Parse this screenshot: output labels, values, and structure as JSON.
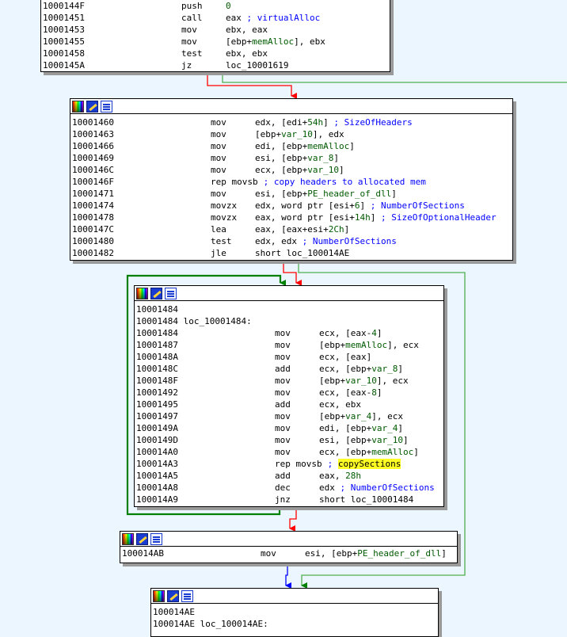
{
  "colors": {
    "background": "#ebf6fe",
    "edge_true": "#008000",
    "edge_false": "#ff0000",
    "edge_uncond": "#0000ff",
    "highlight": "#ffff26"
  },
  "node_toolbar_icons": [
    "color-palette-icon",
    "rename-icon",
    "graph-overview-icon"
  ],
  "block1": {
    "lines": [
      {
        "addr": "1000144F",
        "mn": "push",
        "ops": [
          {
            "t": "0",
            "c": "ref"
          }
        ]
      },
      {
        "addr": "10001451",
        "mn": "call",
        "ops": [
          {
            "t": "eax "
          },
          {
            "t": "; virtualAlloc",
            "c": "cmt"
          }
        ]
      },
      {
        "addr": "10001453",
        "mn": "mov",
        "ops": [
          {
            "t": "ebx, eax"
          }
        ]
      },
      {
        "addr": "10001455",
        "mn": "mov",
        "ops": [
          {
            "t": "[ebp+"
          },
          {
            "t": "memAlloc",
            "c": "ref"
          },
          {
            "t": "], ebx"
          }
        ]
      },
      {
        "addr": "10001458",
        "mn": "test",
        "ops": [
          {
            "t": "ebx, ebx"
          }
        ]
      },
      {
        "addr": "1000145A",
        "mn": "jz",
        "ops": [
          {
            "t": "loc_10001619"
          }
        ]
      }
    ]
  },
  "block2": {
    "lines": [
      {
        "addr": "10001460",
        "mn": "mov",
        "ops": [
          {
            "t": "edx, [edi+"
          },
          {
            "t": "54h",
            "c": "ref"
          },
          {
            "t": "] "
          },
          {
            "t": "; SizeOfHeaders",
            "c": "cmt"
          }
        ]
      },
      {
        "addr": "10001463",
        "mn": "mov",
        "ops": [
          {
            "t": "[ebp+"
          },
          {
            "t": "var_10",
            "c": "ref"
          },
          {
            "t": "], edx"
          }
        ]
      },
      {
        "addr": "10001466",
        "mn": "mov",
        "ops": [
          {
            "t": "edi, [ebp+"
          },
          {
            "t": "memAlloc",
            "c": "ref"
          },
          {
            "t": "]"
          }
        ]
      },
      {
        "addr": "10001469",
        "mn": "mov",
        "ops": [
          {
            "t": "esi, [ebp+"
          },
          {
            "t": "var_8",
            "c": "ref"
          },
          {
            "t": "]"
          }
        ]
      },
      {
        "addr": "1000146C",
        "mn": "mov",
        "ops": [
          {
            "t": "ecx, [ebp+"
          },
          {
            "t": "var_10",
            "c": "ref"
          },
          {
            "t": "]"
          }
        ]
      },
      {
        "addr": "1000146F",
        "mn": "rep movsb",
        "wide": true,
        "ops": [
          {
            "t": "; copy headers to allocated mem",
            "c": "cmt"
          }
        ]
      },
      {
        "addr": "10001471",
        "mn": "mov",
        "ops": [
          {
            "t": "esi, [ebp+"
          },
          {
            "t": "PE_header_of_dll",
            "c": "ref"
          },
          {
            "t": "]"
          }
        ]
      },
      {
        "addr": "10001474",
        "mn": "movzx",
        "ops": [
          {
            "t": "edx, word ptr [esi+"
          },
          {
            "t": "6",
            "c": "ref"
          },
          {
            "t": "] "
          },
          {
            "t": "; NumberOfSections",
            "c": "cmt"
          }
        ]
      },
      {
        "addr": "10001478",
        "mn": "movzx",
        "ops": [
          {
            "t": "eax, word ptr [esi+"
          },
          {
            "t": "14h",
            "c": "ref"
          },
          {
            "t": "] "
          },
          {
            "t": "; SizeOfOptionalHeader",
            "c": "cmt"
          }
        ]
      },
      {
        "addr": "1000147C",
        "mn": "lea",
        "ops": [
          {
            "t": "eax, [eax+esi+"
          },
          {
            "t": "2Ch",
            "c": "ref"
          },
          {
            "t": "]"
          }
        ]
      },
      {
        "addr": "10001480",
        "mn": "test",
        "ops": [
          {
            "t": "edx, edx "
          },
          {
            "t": "; NumberOfSections",
            "c": "cmt"
          }
        ]
      },
      {
        "addr": "10001482",
        "mn": "jle",
        "ops": [
          {
            "t": "short loc_100014AE"
          }
        ]
      }
    ]
  },
  "block3": {
    "header_lines": [
      {
        "addr": "10001484",
        "label": ""
      },
      {
        "addr": "10001484",
        "label": "loc_10001484:"
      }
    ],
    "lines": [
      {
        "addr": "10001484",
        "mn": "mov",
        "ops": [
          {
            "t": "ecx, [eax-"
          },
          {
            "t": "4",
            "c": "ref"
          },
          {
            "t": "]"
          }
        ]
      },
      {
        "addr": "10001487",
        "mn": "mov",
        "ops": [
          {
            "t": "[ebp+"
          },
          {
            "t": "memAlloc",
            "c": "ref"
          },
          {
            "t": "], ecx"
          }
        ]
      },
      {
        "addr": "1000148A",
        "mn": "mov",
        "ops": [
          {
            "t": "ecx, [eax]"
          }
        ]
      },
      {
        "addr": "1000148C",
        "mn": "add",
        "ops": [
          {
            "t": "ecx, [ebp+"
          },
          {
            "t": "var_8",
            "c": "ref"
          },
          {
            "t": "]"
          }
        ]
      },
      {
        "addr": "1000148F",
        "mn": "mov",
        "ops": [
          {
            "t": "[ebp+"
          },
          {
            "t": "var_10",
            "c": "ref"
          },
          {
            "t": "], ecx"
          }
        ]
      },
      {
        "addr": "10001492",
        "mn": "mov",
        "ops": [
          {
            "t": "ecx, [eax-"
          },
          {
            "t": "8",
            "c": "ref"
          },
          {
            "t": "]"
          }
        ]
      },
      {
        "addr": "10001495",
        "mn": "add",
        "ops": [
          {
            "t": "ecx, ebx"
          }
        ]
      },
      {
        "addr": "10001497",
        "mn": "mov",
        "ops": [
          {
            "t": "[ebp+"
          },
          {
            "t": "var_4",
            "c": "ref"
          },
          {
            "t": "], ecx"
          }
        ]
      },
      {
        "addr": "1000149A",
        "mn": "mov",
        "ops": [
          {
            "t": "edi, [ebp+"
          },
          {
            "t": "var_4",
            "c": "ref"
          },
          {
            "t": "]"
          }
        ]
      },
      {
        "addr": "1000149D",
        "mn": "mov",
        "ops": [
          {
            "t": "esi, [ebp+"
          },
          {
            "t": "var_10",
            "c": "ref"
          },
          {
            "t": "]"
          }
        ]
      },
      {
        "addr": "100014A0",
        "mn": "mov",
        "ops": [
          {
            "t": "ecx, [ebp+"
          },
          {
            "t": "memAlloc",
            "c": "ref"
          },
          {
            "t": "]"
          }
        ]
      },
      {
        "addr": "100014A3",
        "mn": "rep movsb",
        "wide": true,
        "ops": [
          {
            "t": "; ",
            "c": "cmt"
          },
          {
            "t": "copySections",
            "c": "hl"
          }
        ]
      },
      {
        "addr": "100014A5",
        "mn": "add",
        "ops": [
          {
            "t": "eax, "
          },
          {
            "t": "28h",
            "c": "ref"
          }
        ]
      },
      {
        "addr": "100014A8",
        "mn": "dec",
        "ops": [
          {
            "t": "edx "
          },
          {
            "t": "; NumberOfSections",
            "c": "cmt"
          }
        ]
      },
      {
        "addr": "100014A9",
        "mn": "jnz",
        "ops": [
          {
            "t": "short loc_10001484"
          }
        ]
      }
    ]
  },
  "block4": {
    "lines": [
      {
        "addr": "100014AB",
        "mn": "mov",
        "ops": [
          {
            "t": "esi, [ebp+"
          },
          {
            "t": "PE_header_of_dll",
            "c": "ref"
          },
          {
            "t": "]"
          }
        ]
      }
    ]
  },
  "block5": {
    "header_lines": [
      {
        "addr": "100014AE",
        "label": ""
      },
      {
        "addr": "100014AE",
        "label": "loc_100014AE:"
      }
    ]
  }
}
